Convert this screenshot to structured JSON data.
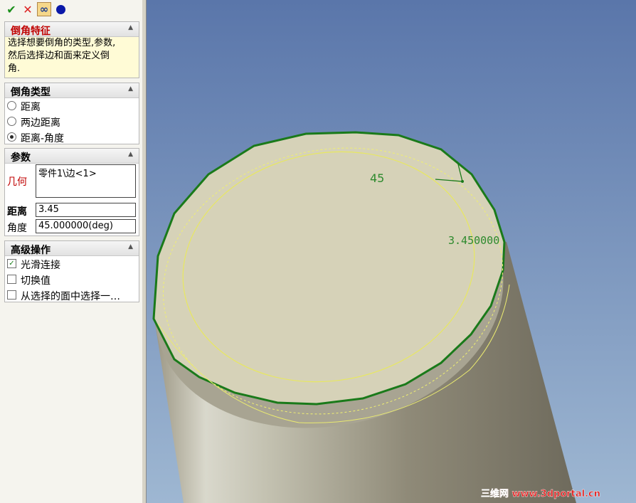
{
  "toolbar": {
    "ok_icon": "checkmark-icon",
    "cancel_icon": "close-icon",
    "preview_icon": "glasses-icon",
    "apply_icon": "circle-icon",
    "ok_glyph": "✔",
    "cancel_glyph": "✕",
    "preview_glyph": "∞"
  },
  "feature": {
    "title": "倒角特征",
    "desc_lines": [
      "选择想要倒角的类型,参数,",
      "然后选择边和面来定义倒",
      "角."
    ]
  },
  "chamfer_type": {
    "title": "倒角类型",
    "options": [
      {
        "label": "距离",
        "selected": false
      },
      {
        "label": "两边距离",
        "selected": false
      },
      {
        "label": "距离-角度",
        "selected": true
      }
    ]
  },
  "params": {
    "title": "参数",
    "geometry_label": "几何",
    "geometry_value": "零件1\\边<1>",
    "distance_label": "距离",
    "distance_value": "3.45",
    "angle_label": "角度",
    "angle_value": "45.000000(deg)"
  },
  "advanced": {
    "title": "高级操作",
    "options": [
      {
        "label": "光滑连接",
        "checked": true
      },
      {
        "label": "切换值",
        "checked": false
      },
      {
        "label": "从选择的面中选择一…",
        "checked": false
      }
    ]
  },
  "viewport": {
    "angle_annotation": "45",
    "distance_annotation": "3.450000",
    "watermark": "三维网 www.3dportal.cn"
  },
  "colors": {
    "title_red": "#c00000",
    "desc_bg": "#fffbd6",
    "edge_green": "#1a7a1a",
    "yellow": "#e8e860",
    "sky_top": "#5a76aa",
    "sky_bottom": "#9eb7d2"
  }
}
